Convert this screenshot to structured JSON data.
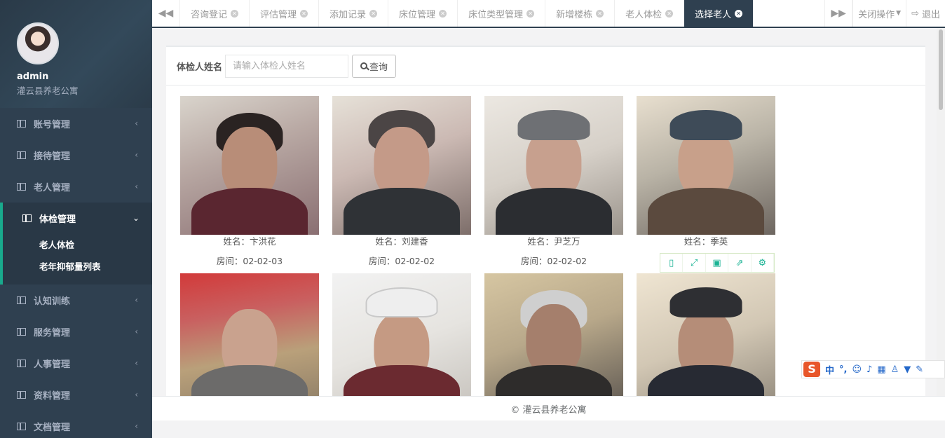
{
  "user": {
    "name": "admin",
    "org": "灌云县养老公寓"
  },
  "nav": [
    {
      "label": "账号管理",
      "active": false
    },
    {
      "label": "接待管理",
      "active": false
    },
    {
      "label": "老人管理",
      "active": false
    },
    {
      "label": "体检管理",
      "active": true,
      "children": [
        "老人体检",
        "老年抑郁量列表"
      ]
    },
    {
      "label": "认知训练",
      "active": false
    },
    {
      "label": "服务管理",
      "active": false
    },
    {
      "label": "人事管理",
      "active": false
    },
    {
      "label": "资料管理",
      "active": false
    },
    {
      "label": "文档管理",
      "active": false
    }
  ],
  "tabs": [
    "咨询登记",
    "评估管理",
    "添加记录",
    "床位管理",
    "床位类型管理",
    "新增楼栋",
    "老人体检",
    "选择老人"
  ],
  "active_tab": "选择老人",
  "topbar": {
    "close_ops": "关闭操作",
    "logout": "退出"
  },
  "search": {
    "label": "体检人姓名",
    "placeholder": "请输入体检人姓名",
    "button": "查询"
  },
  "people": [
    {
      "name": "姓名：卞洪花",
      "room": "房间：02-02-03"
    },
    {
      "name": "姓名：刘建香",
      "room": "房间：02-02-02"
    },
    {
      "name": "姓名：尹芝万",
      "room": "房间：02-02-02"
    },
    {
      "name": "姓名：季英",
      "room": ""
    },
    {
      "name": "",
      "room": ""
    },
    {
      "name": "",
      "room": ""
    },
    {
      "name": "",
      "room": ""
    },
    {
      "name": "",
      "room": ""
    }
  ],
  "footer": "© 灌云县养老公寓",
  "ime": {
    "logo": "S",
    "mode": "中"
  }
}
